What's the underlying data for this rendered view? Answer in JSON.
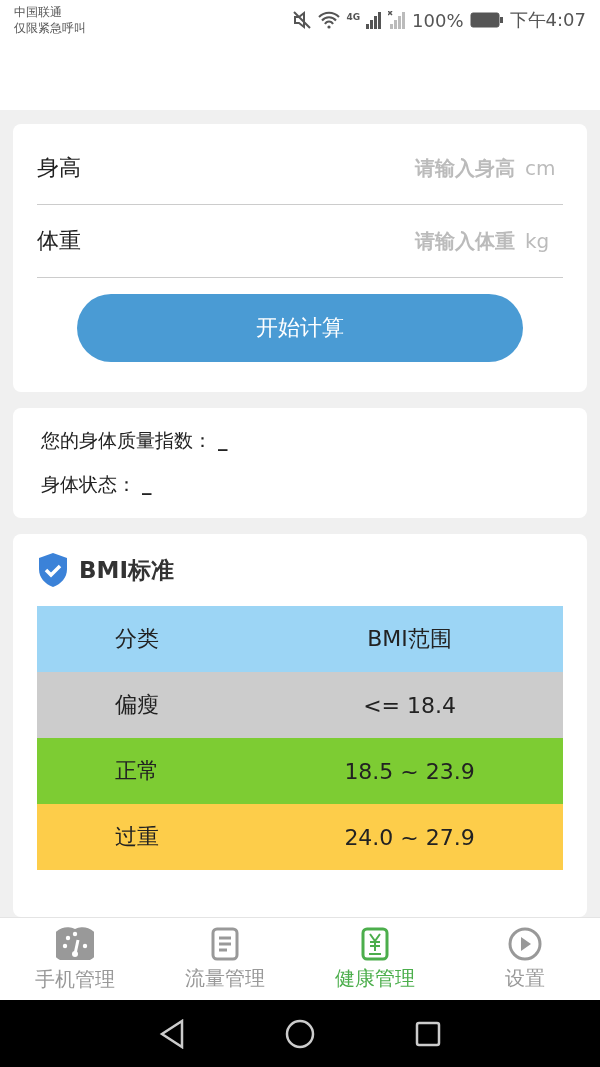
{
  "status_bar": {
    "carrier": "中国联通",
    "carrier_note": "仅限紧急呼叫",
    "network": "4G",
    "battery": "100%",
    "time": "下午4:07"
  },
  "form": {
    "fields": [
      {
        "label": "身高",
        "placeholder": "请输入身高",
        "unit": "cm"
      },
      {
        "label": "体重",
        "placeholder": "请输入体重",
        "unit": "kg"
      }
    ],
    "button": "开始计算"
  },
  "result": [
    {
      "label": "您的身体质量指数：",
      "value": "_"
    },
    {
      "label": "身体状态：",
      "value": "_"
    }
  ],
  "bmi_standard": {
    "title": "BMI标准",
    "columns": [
      "分类",
      "BMI范围"
    ],
    "rows": [
      {
        "category": "偏瘦",
        "range": "<= 18.4",
        "color": "#cccccc"
      },
      {
        "category": "正常",
        "range": "18.5 ~ 23.9",
        "color": "#7dcc33"
      },
      {
        "category": "过重",
        "range": "24.0 ~ 27.9",
        "color": "#fdcd4a"
      }
    ]
  },
  "tabs": [
    {
      "label": "手机管理",
      "kind": "gauge",
      "selected": false
    },
    {
      "label": "流量管理",
      "kind": "list",
      "selected": false
    },
    {
      "label": "健康管理",
      "kind": "yen",
      "selected": true
    },
    {
      "label": "设置",
      "kind": "play",
      "selected": false
    }
  ]
}
